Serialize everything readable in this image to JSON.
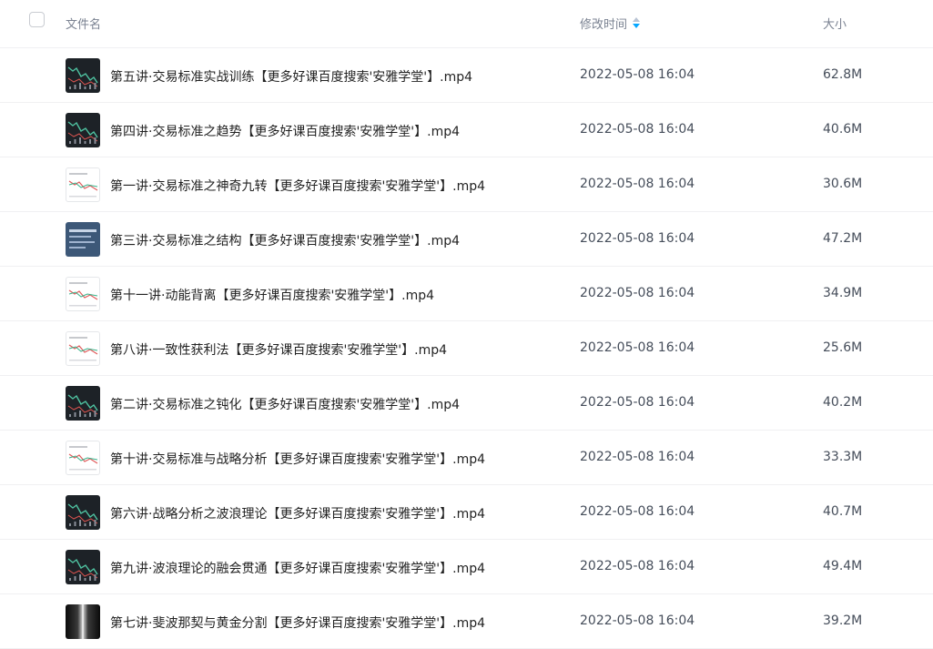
{
  "header": {
    "name_label": "文件名",
    "time_label": "修改时间",
    "size_label": "大小",
    "sort_icon": "sort-desc-icon"
  },
  "colors": {
    "accent": "#06a7ff",
    "header_text": "#7a8291",
    "row_border": "#f0f0f2"
  },
  "files": [
    {
      "name": "第五讲·交易标准实战训练【更多好课百度搜索'安雅学堂'】.mp4",
      "modified": "2022-05-08 16:04",
      "size": "62.8M",
      "thumb": "dark"
    },
    {
      "name": "第四讲·交易标准之趋势【更多好课百度搜索'安雅学堂'】.mp4",
      "modified": "2022-05-08 16:04",
      "size": "40.6M",
      "thumb": "dark"
    },
    {
      "name": "第一讲·交易标准之神奇九转【更多好课百度搜索'安雅学堂'】.mp4",
      "modified": "2022-05-08 16:04",
      "size": "30.6M",
      "thumb": "light"
    },
    {
      "name": "第三讲·交易标准之结构【更多好课百度搜索'安雅学堂'】.mp4",
      "modified": "2022-05-08 16:04",
      "size": "47.2M",
      "thumb": "blue"
    },
    {
      "name": "第十一讲·动能背离【更多好课百度搜索'安雅学堂'】.mp4",
      "modified": "2022-05-08 16:04",
      "size": "34.9M",
      "thumb": "light"
    },
    {
      "name": "第八讲·一致性获利法【更多好课百度搜索'安雅学堂'】.mp4",
      "modified": "2022-05-08 16:04",
      "size": "25.6M",
      "thumb": "light"
    },
    {
      "name": "第二讲·交易标准之钝化【更多好课百度搜索'安雅学堂'】.mp4",
      "modified": "2022-05-08 16:04",
      "size": "40.2M",
      "thumb": "dark"
    },
    {
      "name": "第十讲·交易标准与战略分析【更多好课百度搜索'安雅学堂'】.mp4",
      "modified": "2022-05-08 16:04",
      "size": "33.3M",
      "thumb": "light"
    },
    {
      "name": "第六讲·战略分析之波浪理论【更多好课百度搜索'安雅学堂'】.mp4",
      "modified": "2022-05-08 16:04",
      "size": "40.7M",
      "thumb": "dark"
    },
    {
      "name": "第九讲·波浪理论的融会贯通【更多好课百度搜索'安雅学堂'】.mp4",
      "modified": "2022-05-08 16:04",
      "size": "49.4M",
      "thumb": "dark"
    },
    {
      "name": "第七讲·斐波那契与黄金分割【更多好课百度搜索'安雅学堂'】.mp4",
      "modified": "2022-05-08 16:04",
      "size": "39.2M",
      "thumb": "metal"
    }
  ]
}
